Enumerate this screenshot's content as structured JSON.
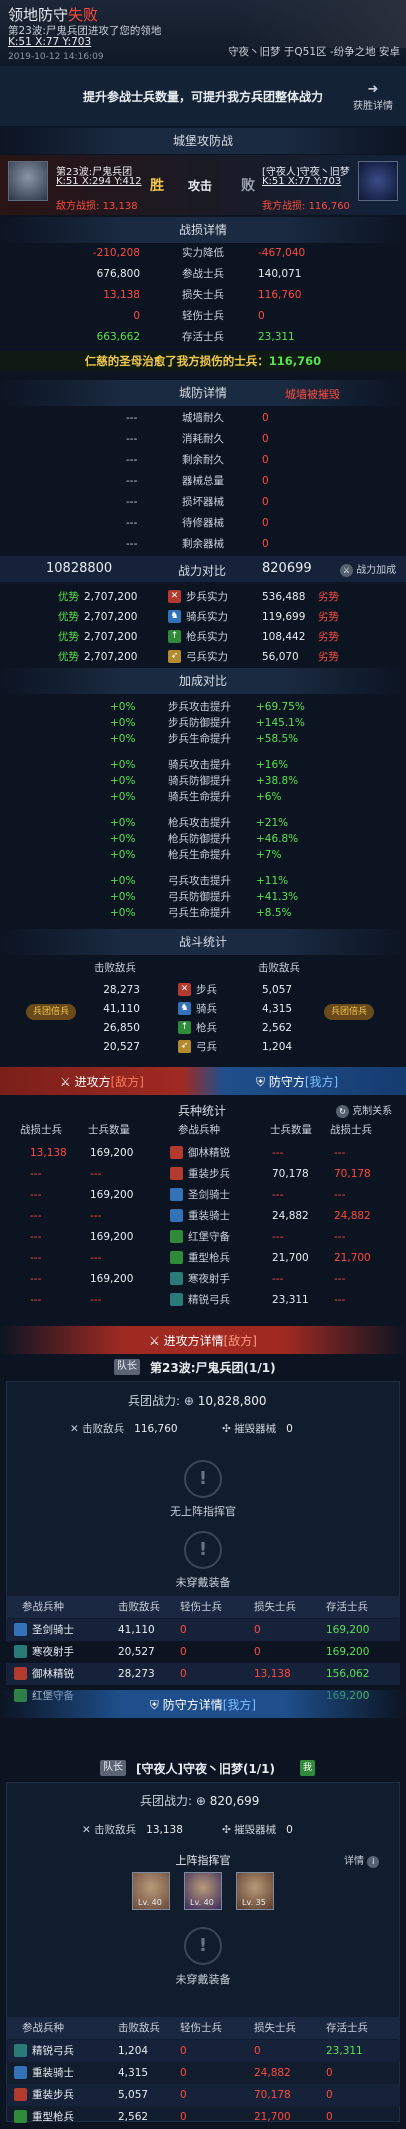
{
  "header": {
    "title_a": "领地防守",
    "title_b": "失败",
    "subtitle": "第23波:尸鬼兵团进攻了您的领地",
    "coord": "K:51 X:77 Y:703",
    "datetime": "2019-10-12 14:16:09",
    "location": "守夜丶旧梦 于Q51区 -纷争之地 安卓"
  },
  "tip": {
    "text": "提升参战士兵数量，可提升我方兵团整体战力",
    "more": "获胜详情"
  },
  "castle": {
    "title": "城堡攻防战",
    "left_name": "第23波:尸鬼兵团",
    "left_coord": "K:51 X:294 Y:412",
    "win": "胜",
    "attack": "攻击",
    "lose": "败",
    "right_name": "[守夜人]守夜丶旧梦",
    "right_coord": "K:51 X:77 Y:703",
    "left_power_label": "敌方战损:",
    "left_power": "13,138",
    "right_power_label": "我方战损:",
    "right_power": "116,760"
  },
  "battle": {
    "title": "战损详情",
    "rows": [
      {
        "l": "-210,208",
        "m": "实力降低",
        "r": "-467,040",
        "lc": "red",
        "rc": "red"
      },
      {
        "l": "676,800",
        "m": "参战士兵",
        "r": "140,071",
        "lc": "wht",
        "rc": "wht"
      },
      {
        "l": "13,138",
        "m": "损失士兵",
        "r": "116,760",
        "lc": "red",
        "rc": "red"
      },
      {
        "l": "0",
        "m": "轻伤士兵",
        "r": "0",
        "lc": "red",
        "rc": "red"
      },
      {
        "l": "663,662",
        "m": "存活士兵",
        "r": "23,311",
        "lc": "grn",
        "rc": "grn"
      }
    ],
    "heal": "仁慈的圣母治愈了我方损伤的士兵：",
    "heal_val": "116,760"
  },
  "city": {
    "title": "城防详情",
    "status": "城墙被摧毁",
    "rows": [
      {
        "l": "---",
        "m": "城墙耐久",
        "r": "0"
      },
      {
        "l": "---",
        "m": "消耗耐久",
        "r": "0"
      },
      {
        "l": "---",
        "m": "剩余耐久",
        "r": "0"
      },
      {
        "l": "---",
        "m": "器械总量",
        "r": "0"
      },
      {
        "l": "---",
        "m": "损坏器械",
        "r": "0"
      },
      {
        "l": "---",
        "m": "待修器械",
        "r": "0"
      },
      {
        "l": "---",
        "m": "剩余器械",
        "r": "0"
      }
    ]
  },
  "power": {
    "left": "10828800",
    "title": "战力对比",
    "right": "820699",
    "add": "战力加成",
    "rows": [
      {
        "tag": "优势",
        "l": "2,707,200",
        "icon": "✕",
        "m": "步兵实力",
        "r": "536,488",
        "rt": "劣势"
      },
      {
        "tag": "优势",
        "l": "2,707,200",
        "icon": "♞",
        "m": "骑兵实力",
        "r": "119,699",
        "rt": "劣势"
      },
      {
        "tag": "优势",
        "l": "2,707,200",
        "icon": "↑",
        "m": "枪兵实力",
        "r": "108,442",
        "rt": "劣势"
      },
      {
        "tag": "优势",
        "l": "2,707,200",
        "icon": "➶",
        "m": "弓兵实力",
        "r": "56,070",
        "rt": "劣势"
      }
    ]
  },
  "bonus": {
    "title": "加成对比",
    "groups": [
      [
        {
          "l": "+0%",
          "m": "步兵攻击提升",
          "r": "+69.75%"
        },
        {
          "l": "+0%",
          "m": "步兵防御提升",
          "r": "+145.1%"
        },
        {
          "l": "+0%",
          "m": "步兵生命提升",
          "r": "+58.5%"
        }
      ],
      [
        {
          "l": "+0%",
          "m": "骑兵攻击提升",
          "r": "+16%"
        },
        {
          "l": "+0%",
          "m": "骑兵防御提升",
          "r": "+38.8%"
        },
        {
          "l": "+0%",
          "m": "骑兵生命提升",
          "r": "+6%"
        }
      ],
      [
        {
          "l": "+0%",
          "m": "枪兵攻击提升",
          "r": "+21%"
        },
        {
          "l": "+0%",
          "m": "枪兵防御提升",
          "r": "+46.8%"
        },
        {
          "l": "+0%",
          "m": "枪兵生命提升",
          "r": "+7%"
        }
      ],
      [
        {
          "l": "+0%",
          "m": "弓兵攻击提升",
          "r": "+11%"
        },
        {
          "l": "+0%",
          "m": "弓兵防御提升",
          "r": "+41.3%"
        },
        {
          "l": "+0%",
          "m": "弓兵生命提升",
          "r": "+8.5%"
        }
      ]
    ]
  },
  "stats": {
    "title": "战斗统计",
    "lh": "击败敌兵",
    "rh": "击败敌兵",
    "lbadge": "兵团倍兵",
    "rbadge": "兵团倍兵",
    "rows": [
      {
        "l": "28,273",
        "m": "步兵",
        "r": "5,057"
      },
      {
        "l": "41,110",
        "m": "骑兵",
        "r": "4,315"
      },
      {
        "l": "26,850",
        "m": "枪兵",
        "r": "2,562"
      },
      {
        "l": "20,527",
        "m": "弓兵",
        "r": "1,204"
      }
    ]
  },
  "sides": {
    "atk": "进攻方",
    "atk_tag": "[敌方]",
    "def": "防守方",
    "def_tag": "[我方]"
  },
  "troops": {
    "title": "兵种统计",
    "relation": "克制关系",
    "headers": [
      "战损士兵",
      "士兵数量",
      "参战兵种",
      "士兵数量",
      "战损士兵"
    ],
    "rows": [
      {
        "a": "13,138",
        "b": "169,200",
        "m": "御林精锐",
        "c": "---",
        "d": "---"
      },
      {
        "a": "---",
        "b": "---",
        "m": "重装步兵",
        "c": "70,178",
        "d": "70,178"
      },
      {
        "a": "---",
        "b": "169,200",
        "m": "圣剑骑士",
        "c": "---",
        "d": "---"
      },
      {
        "a": "---",
        "b": "---",
        "m": "重装骑士",
        "c": "24,882",
        "d": "24,882"
      },
      {
        "a": "---",
        "b": "169,200",
        "m": "红堡守备",
        "c": "---",
        "d": "---"
      },
      {
        "a": "---",
        "b": "---",
        "m": "重型枪兵",
        "c": "21,700",
        "d": "21,700"
      },
      {
        "a": "---",
        "b": "169,200",
        "m": "寒夜射手",
        "c": "---",
        "d": "---"
      },
      {
        "a": "---",
        "b": "---",
        "m": "精锐弓兵",
        "c": "23,311",
        "d": "---"
      }
    ]
  },
  "atk_detail": {
    "banner": "进攻方详情",
    "banner_tag": "[敌方]",
    "captain": "队长",
    "name": "第23波:尸鬼兵团(1/1)",
    "power_label": "兵团战力:",
    "power": "10,828,800",
    "kill_label": "击败敌兵",
    "kill": "116,760",
    "destroy_label": "摧毁器械",
    "destroy": "0",
    "no_cmd": "无上阵指挥官",
    "no_equip": "未穿戴装备",
    "headers": [
      "参战兵种",
      "击败敌兵",
      "轻伤士兵",
      "损失士兵",
      "存活士兵"
    ],
    "rows": [
      {
        "n": "圣剑骑士",
        "a": "41,110",
        "b": "0",
        "c": "0",
        "d": "169,200"
      },
      {
        "n": "寒夜射手",
        "a": "20,527",
        "b": "0",
        "c": "0",
        "d": "169,200"
      },
      {
        "n": "御林精锐",
        "a": "28,273",
        "b": "0",
        "c": "13,138",
        "d": "156,062"
      },
      {
        "n": "红堡守备",
        "a": "26,850",
        "b": "0",
        "c": "0",
        "d": "169,200"
      }
    ]
  },
  "def_detail": {
    "banner": "防守方详情",
    "banner_tag": "[我方]",
    "captain": "队长",
    "name": "[守夜人]守夜丶旧梦(1/1)",
    "badge": "我",
    "power_label": "兵团战力:",
    "power": "820,699",
    "kill_label": "击败敌兵",
    "kill": "13,138",
    "destroy_label": "摧毁器械",
    "destroy": "0",
    "cmd": "上阵指挥官",
    "detail": "详情",
    "heroes": [
      "Lv. 40",
      "Lv. 40",
      "Lv. 35"
    ],
    "no_equip": "未穿戴装备",
    "headers": [
      "参战兵种",
      "击败敌兵",
      "轻伤士兵",
      "损失士兵",
      "存活士兵"
    ],
    "rows": [
      {
        "n": "精锐弓兵",
        "a": "1,204",
        "b": "0",
        "c": "0",
        "d": "23,311"
      },
      {
        "n": "重装骑士",
        "a": "4,315",
        "b": "0",
        "c": "24,882",
        "d": "0"
      },
      {
        "n": "重装步兵",
        "a": "5,057",
        "b": "0",
        "c": "70,178",
        "d": "0"
      },
      {
        "n": "重型枪兵",
        "a": "2,562",
        "b": "0",
        "c": "21,700",
        "d": "0"
      }
    ]
  }
}
